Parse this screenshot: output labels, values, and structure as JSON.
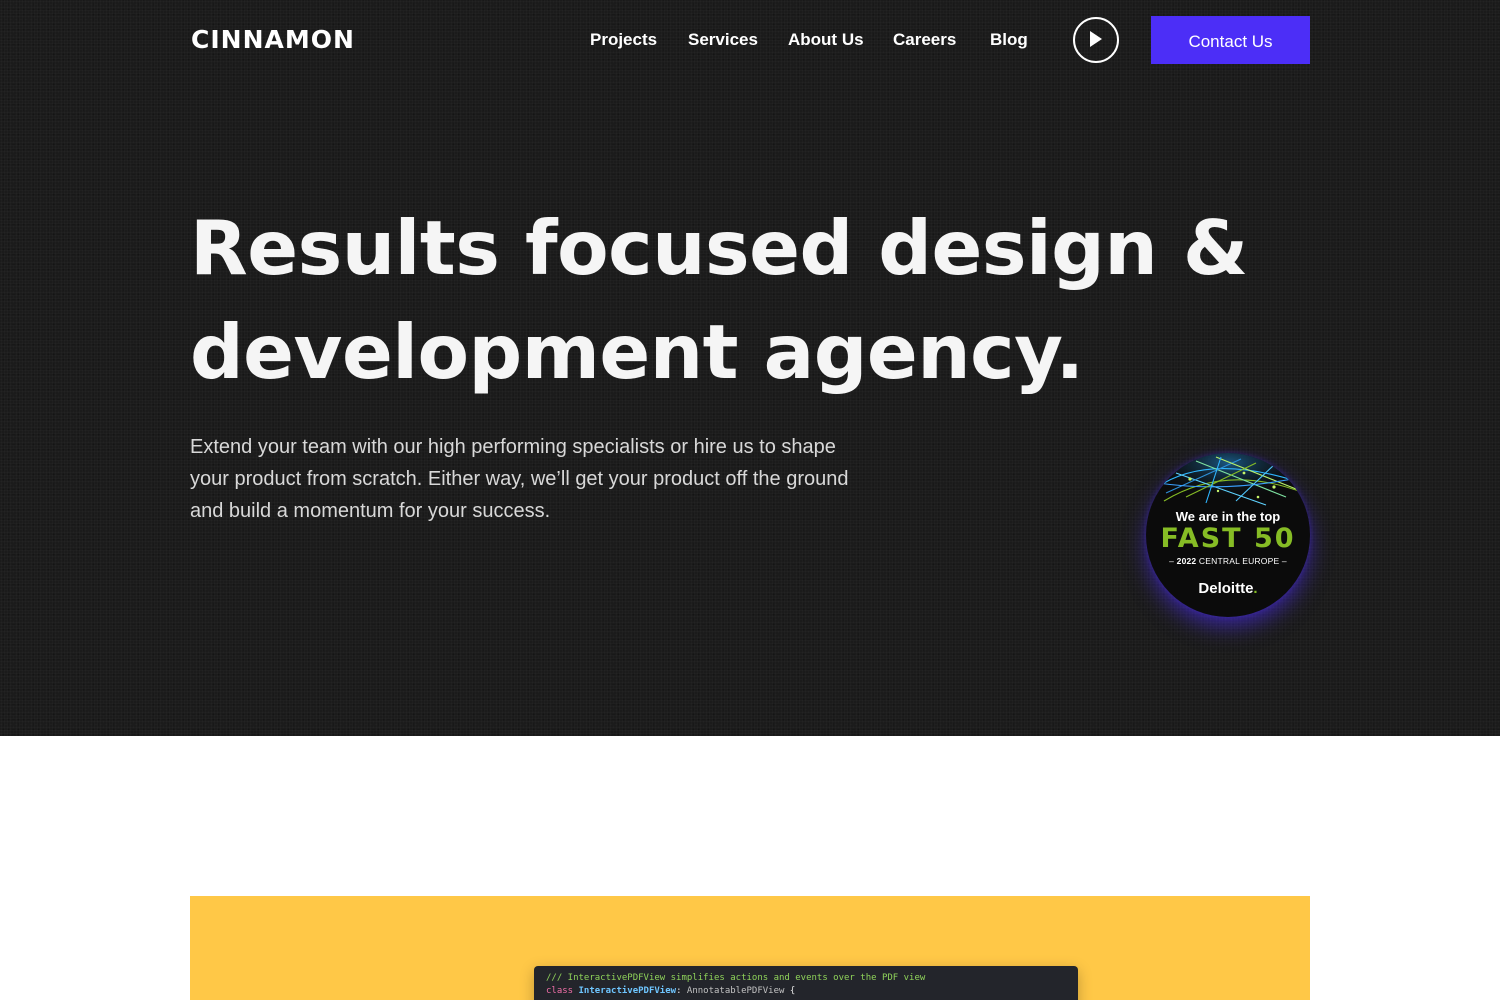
{
  "header": {
    "logo": "CINNAMON",
    "nav": [
      {
        "label": "Projects"
      },
      {
        "label": "Services"
      },
      {
        "label": "About Us"
      },
      {
        "label": "Careers"
      },
      {
        "label": "Blog"
      }
    ],
    "play_icon": "play-icon",
    "contact_label": "Contact Us"
  },
  "hero": {
    "title_line1": "Results focused design &",
    "title_line2": "development agency.",
    "subtext": "Extend your team with our high performing specialists or hire us to shape your product from scratch. Either way, we’ll get your product off the ground and build a momentum for your success."
  },
  "badge": {
    "line1": "We are in the top",
    "fast": "FAST 50",
    "year": "2022",
    "region": "CENTRAL EUROPE",
    "brand": "Deloitte",
    "brand_dot": "."
  },
  "code": {
    "comment": "/// InteractivePDFView simplifies actions and events over the PDF view",
    "keyword": "class",
    "class_name": "InteractivePDFView",
    "colon": ":",
    "parent": "AnnotatablePDFView",
    "brace": "{"
  },
  "colors": {
    "hero_bg": "#1b1b1b",
    "accent": "#4c2ef7",
    "feature_bg": "#ffc847",
    "deloitte_green": "#86bc25"
  }
}
